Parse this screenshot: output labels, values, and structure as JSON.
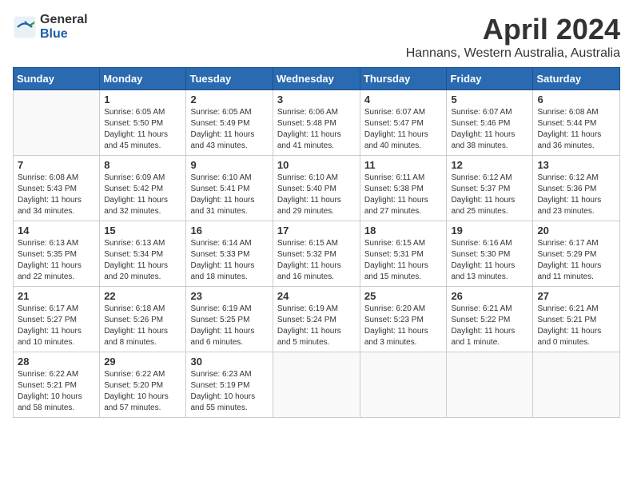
{
  "logo": {
    "general": "General",
    "blue": "Blue"
  },
  "title": "April 2024",
  "subtitle": "Hannans, Western Australia, Australia",
  "headers": [
    "Sunday",
    "Monday",
    "Tuesday",
    "Wednesday",
    "Thursday",
    "Friday",
    "Saturday"
  ],
  "weeks": [
    [
      {
        "day": "",
        "info": ""
      },
      {
        "day": "1",
        "info": "Sunrise: 6:05 AM\nSunset: 5:50 PM\nDaylight: 11 hours\nand 45 minutes."
      },
      {
        "day": "2",
        "info": "Sunrise: 6:05 AM\nSunset: 5:49 PM\nDaylight: 11 hours\nand 43 minutes."
      },
      {
        "day": "3",
        "info": "Sunrise: 6:06 AM\nSunset: 5:48 PM\nDaylight: 11 hours\nand 41 minutes."
      },
      {
        "day": "4",
        "info": "Sunrise: 6:07 AM\nSunset: 5:47 PM\nDaylight: 11 hours\nand 40 minutes."
      },
      {
        "day": "5",
        "info": "Sunrise: 6:07 AM\nSunset: 5:46 PM\nDaylight: 11 hours\nand 38 minutes."
      },
      {
        "day": "6",
        "info": "Sunrise: 6:08 AM\nSunset: 5:44 PM\nDaylight: 11 hours\nand 36 minutes."
      }
    ],
    [
      {
        "day": "7",
        "info": "Sunrise: 6:08 AM\nSunset: 5:43 PM\nDaylight: 11 hours\nand 34 minutes."
      },
      {
        "day": "8",
        "info": "Sunrise: 6:09 AM\nSunset: 5:42 PM\nDaylight: 11 hours\nand 32 minutes."
      },
      {
        "day": "9",
        "info": "Sunrise: 6:10 AM\nSunset: 5:41 PM\nDaylight: 11 hours\nand 31 minutes."
      },
      {
        "day": "10",
        "info": "Sunrise: 6:10 AM\nSunset: 5:40 PM\nDaylight: 11 hours\nand 29 minutes."
      },
      {
        "day": "11",
        "info": "Sunrise: 6:11 AM\nSunset: 5:38 PM\nDaylight: 11 hours\nand 27 minutes."
      },
      {
        "day": "12",
        "info": "Sunrise: 6:12 AM\nSunset: 5:37 PM\nDaylight: 11 hours\nand 25 minutes."
      },
      {
        "day": "13",
        "info": "Sunrise: 6:12 AM\nSunset: 5:36 PM\nDaylight: 11 hours\nand 23 minutes."
      }
    ],
    [
      {
        "day": "14",
        "info": "Sunrise: 6:13 AM\nSunset: 5:35 PM\nDaylight: 11 hours\nand 22 minutes."
      },
      {
        "day": "15",
        "info": "Sunrise: 6:13 AM\nSunset: 5:34 PM\nDaylight: 11 hours\nand 20 minutes."
      },
      {
        "day": "16",
        "info": "Sunrise: 6:14 AM\nSunset: 5:33 PM\nDaylight: 11 hours\nand 18 minutes."
      },
      {
        "day": "17",
        "info": "Sunrise: 6:15 AM\nSunset: 5:32 PM\nDaylight: 11 hours\nand 16 minutes."
      },
      {
        "day": "18",
        "info": "Sunrise: 6:15 AM\nSunset: 5:31 PM\nDaylight: 11 hours\nand 15 minutes."
      },
      {
        "day": "19",
        "info": "Sunrise: 6:16 AM\nSunset: 5:30 PM\nDaylight: 11 hours\nand 13 minutes."
      },
      {
        "day": "20",
        "info": "Sunrise: 6:17 AM\nSunset: 5:29 PM\nDaylight: 11 hours\nand 11 minutes."
      }
    ],
    [
      {
        "day": "21",
        "info": "Sunrise: 6:17 AM\nSunset: 5:27 PM\nDaylight: 11 hours\nand 10 minutes."
      },
      {
        "day": "22",
        "info": "Sunrise: 6:18 AM\nSunset: 5:26 PM\nDaylight: 11 hours\nand 8 minutes."
      },
      {
        "day": "23",
        "info": "Sunrise: 6:19 AM\nSunset: 5:25 PM\nDaylight: 11 hours\nand 6 minutes."
      },
      {
        "day": "24",
        "info": "Sunrise: 6:19 AM\nSunset: 5:24 PM\nDaylight: 11 hours\nand 5 minutes."
      },
      {
        "day": "25",
        "info": "Sunrise: 6:20 AM\nSunset: 5:23 PM\nDaylight: 11 hours\nand 3 minutes."
      },
      {
        "day": "26",
        "info": "Sunrise: 6:21 AM\nSunset: 5:22 PM\nDaylight: 11 hours\nand 1 minute."
      },
      {
        "day": "27",
        "info": "Sunrise: 6:21 AM\nSunset: 5:21 PM\nDaylight: 11 hours\nand 0 minutes."
      }
    ],
    [
      {
        "day": "28",
        "info": "Sunrise: 6:22 AM\nSunset: 5:21 PM\nDaylight: 10 hours\nand 58 minutes."
      },
      {
        "day": "29",
        "info": "Sunrise: 6:22 AM\nSunset: 5:20 PM\nDaylight: 10 hours\nand 57 minutes."
      },
      {
        "day": "30",
        "info": "Sunrise: 6:23 AM\nSunset: 5:19 PM\nDaylight: 10 hours\nand 55 minutes."
      },
      {
        "day": "",
        "info": ""
      },
      {
        "day": "",
        "info": ""
      },
      {
        "day": "",
        "info": ""
      },
      {
        "day": "",
        "info": ""
      }
    ]
  ]
}
